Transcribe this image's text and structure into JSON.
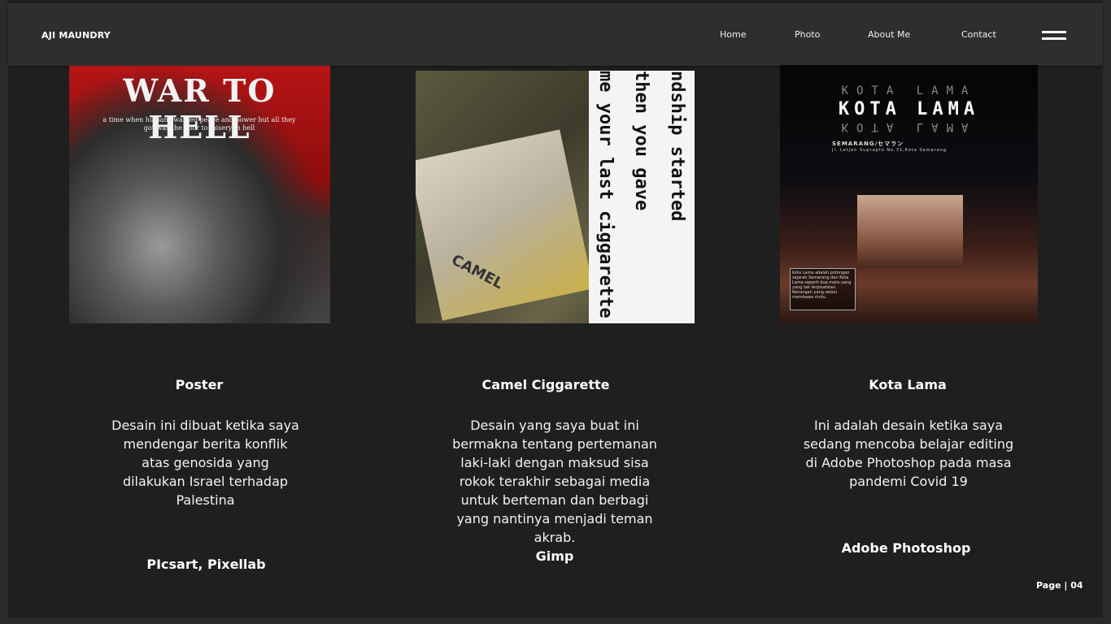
{
  "brand": "AJI MAUNDRY",
  "nav": {
    "home": "Home",
    "photo": "Photo",
    "about": "About Me",
    "contact": "Contact"
  },
  "cards": [
    {
      "image_text": {
        "title": "WAR TO HELL",
        "subtitle": "a time when humans wanted peace and power but all they got was the door to misery in hell"
      },
      "title": "Poster",
      "description": "Desain ini dibuat ketika saya mendengar berita konflik atas genosida yang dilakukan Israel terhadap Palestina",
      "tool": "PIcsart, Pixellab"
    },
    {
      "image_text": {
        "strip_1": "then you gave",
        "strip_2": "me your last ciggarette",
        "strip_3": "ndship started",
        "pack_label": "CAMEL"
      },
      "title": "Camel Ciggarette",
      "description": "Desain yang saya buat ini bermakna tentang pertemanan laki-laki dengan maksud sisa rokok terakhir sebagai media untuk berteman dan berbagi yang nantinya menjadi teman akrab.",
      "tool": "Gimp"
    },
    {
      "image_text": {
        "title": "KOTA LAMA",
        "city": "SEMARANG/セマラン",
        "address": "Jl. Letjen Suprapto No.31,Kota Semarang",
        "caption": "Kota Lama adalah potongan sejarah Semarang dan Kota Lama seperti dua mata uang yang tak terpisahkan. Kenangan yang selalu membawa rindu."
      },
      "title": "Kota Lama",
      "description": "Ini adalah desain ketika saya sedang mencoba belajar editing di Adobe Photoshop pada masa pandemi Covid 19",
      "tool": "Adobe Photoshop"
    }
  ],
  "page": "Page | 04",
  "colors": {
    "background": "#1f1f1f",
    "navbar": "#2e2e2e",
    "text": "#ffffff"
  }
}
